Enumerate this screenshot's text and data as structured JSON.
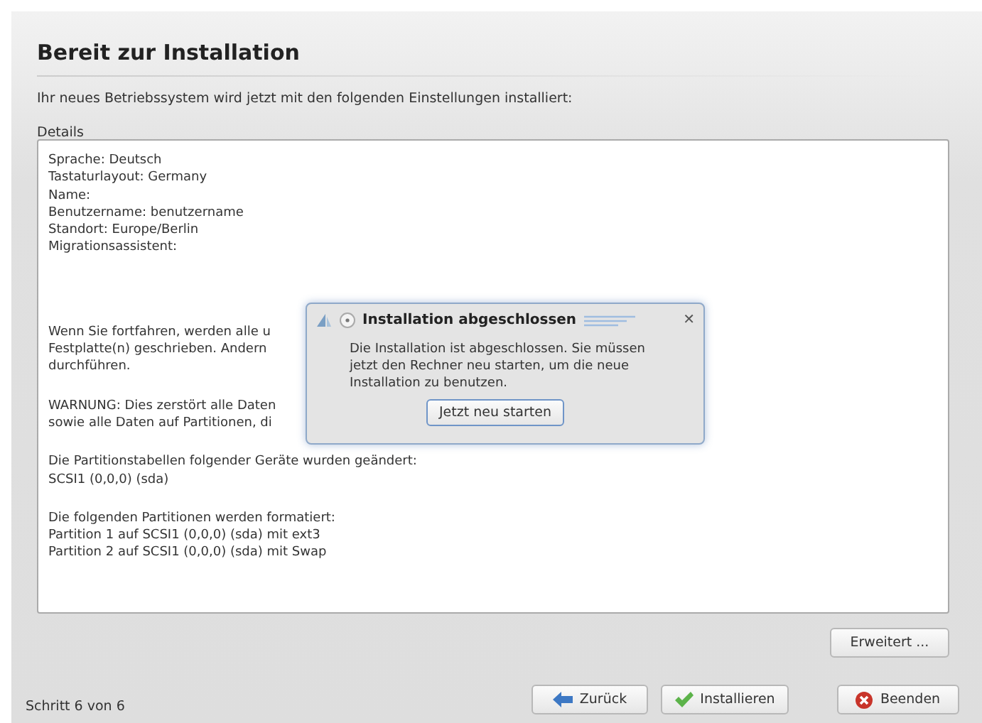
{
  "page": {
    "title": "Bereit zur Installation",
    "subtitle": "Ihr neues Betriebssystem wird jetzt mit den folgenden Einstellungen installiert:",
    "details_label": "Details"
  },
  "details": [
    {
      "lines": [
        "Sprache: Deutsch",
        "Tastaturlayout: Germany",
        "Name:",
        "Benutzername: benutzername",
        "Standort: Europe/Berlin",
        "Migrationsassistent:"
      ]
    },
    {
      "lines": [
        "Wenn Sie fortfahren, werden alle u",
        "Festplatte(n) geschrieben. Andern",
        "durchführen."
      ]
    },
    {
      "lines": [
        "WARNUNG: Dies zerstört alle Daten",
        "sowie alle Daten auf Partitionen, di"
      ]
    },
    {
      "lines": [
        "Die Partitionstabellen folgender Geräte wurden geändert:",
        "SCSI1 (0,0,0) (sda)"
      ]
    },
    {
      "lines": [
        "Die folgenden Partitionen werden formatiert:",
        "Partition 1 auf SCSI1 (0,0,0) (sda) mit ext3",
        "Partition 2 auf SCSI1 (0,0,0) (sda) mit Swap"
      ]
    }
  ],
  "advanced_button": "Erweitert ...",
  "step": "Schritt 6 von 6",
  "buttons": [
    {
      "kind": "back",
      "label": "Zurück"
    },
    {
      "kind": "install",
      "label": "Installieren"
    },
    {
      "kind": "quit",
      "label": "Beenden"
    }
  ],
  "dialog": {
    "title": "Installation abgeschlossen",
    "close": "✕",
    "message": "Die Installation ist abgeschlossen. Sie müssen jetzt den Rechner neu starten, um die neue Installation zu benutzen.",
    "button": "Jetzt neu starten"
  }
}
